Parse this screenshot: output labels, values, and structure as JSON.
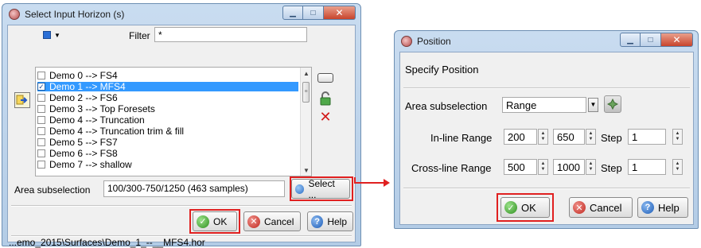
{
  "left_dialog": {
    "title": "Select Input Horizon (s)",
    "filter_label": "Filter",
    "filter_value": "*",
    "horizons": [
      {
        "label": "Demo 0 --> FS4",
        "checked": false,
        "selected": false
      },
      {
        "label": "Demo 1 --> MFS4",
        "checked": true,
        "selected": true
      },
      {
        "label": "Demo 2 --> FS6",
        "checked": false,
        "selected": false
      },
      {
        "label": "Demo 3  --> Top Foresets",
        "checked": false,
        "selected": false
      },
      {
        "label": "Demo 4 --> Truncation",
        "checked": false,
        "selected": false
      },
      {
        "label": "Demo 4 --> Truncation trim & fill",
        "checked": false,
        "selected": false
      },
      {
        "label": "Demo 5 --> FS7",
        "checked": false,
        "selected": false
      },
      {
        "label": "Demo 6 --> FS8",
        "checked": false,
        "selected": false
      },
      {
        "label": "Demo 7 --> shallow",
        "checked": false,
        "selected": false
      }
    ],
    "area_label": "Area subselection",
    "area_value": "100/300-750/1250 (463 samples)",
    "select_button": "Select ...",
    "ok_button": "OK",
    "cancel_button": "Cancel",
    "help_button": "Help",
    "status_path": "...emo_2015\\Surfaces\\Demo_1_--__MFS4.hor"
  },
  "right_dialog": {
    "title": "Position",
    "heading": "Specify Position",
    "area_label": "Area subselection",
    "area_value": "Range",
    "inline_label": "In-line Range",
    "inline_start": "200",
    "inline_stop": "650",
    "inline_step_label": "Step",
    "inline_step": "1",
    "crossline_label": "Cross-line Range",
    "crossline_start": "500",
    "crossline_stop": "1000",
    "crossline_step_label": "Step",
    "crossline_step": "1",
    "ok_button": "OK",
    "cancel_button": "Cancel",
    "help_button": "Help"
  },
  "colors": {
    "highlight_border": "#e02020",
    "selection": "#3399ff",
    "ok_icon": "#2f8f1f",
    "cancel_icon": "#c0271e",
    "help_icon": "#1d5db8"
  }
}
